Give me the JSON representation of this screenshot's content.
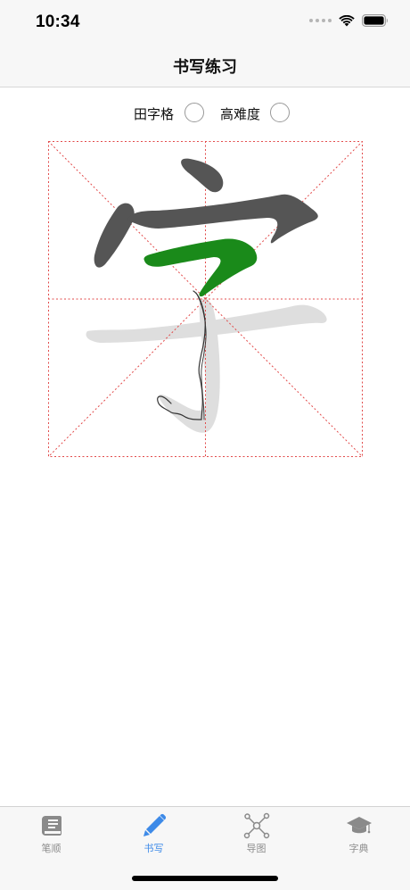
{
  "status_bar": {
    "time": "10:34",
    "wifi_icon": "wifi-icon",
    "battery_icon": "battery-icon"
  },
  "nav": {
    "title": "书写练习"
  },
  "options": {
    "grid_label": "田字格",
    "grid_checked": false,
    "hard_label": "高难度",
    "hard_checked": false
  },
  "practice": {
    "character": "字",
    "current_stroke_color": "#1a8a1a",
    "done_stroke_color": "#555555",
    "remaining_stroke_color": "#dedede",
    "grid_line_color": "#e24a4a"
  },
  "tabs": [
    {
      "label": "笔顺",
      "icon": "book-icon",
      "active": false
    },
    {
      "label": "书写",
      "icon": "pencil-icon",
      "active": true
    },
    {
      "label": "导图",
      "icon": "mindmap-icon",
      "active": false
    },
    {
      "label": "字典",
      "icon": "graduation-cap-icon",
      "active": false
    }
  ],
  "colors": {
    "accent": "#3d8ae8",
    "inactive_tab": "#8e8e8e",
    "bar_background": "#f7f7f7"
  }
}
